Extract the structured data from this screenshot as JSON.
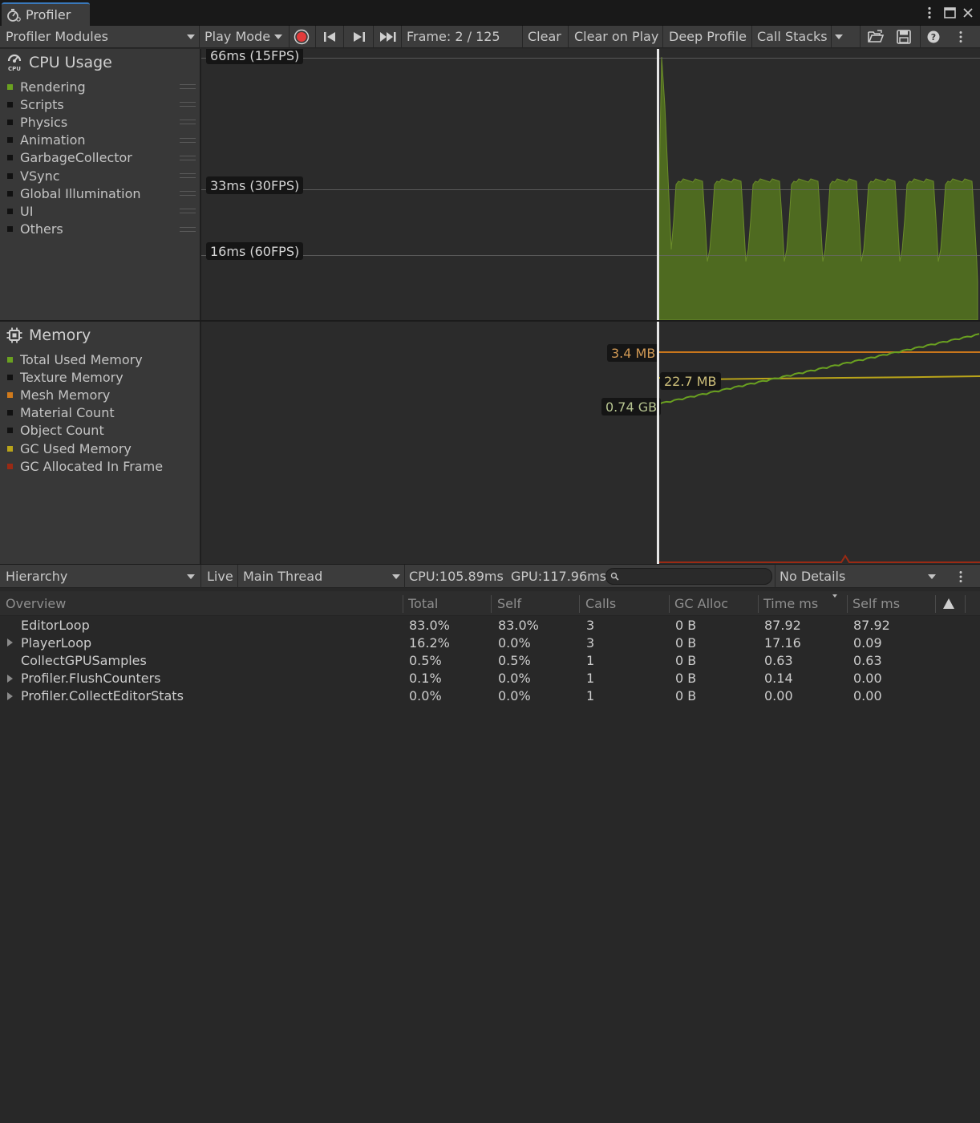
{
  "window": {
    "tab_label": "Profiler",
    "menu_icon": "kebab-vertical-icon",
    "maximize_icon": "maximize-icon",
    "close_icon": "close-icon"
  },
  "toolbar": {
    "modules_label": "Profiler Modules",
    "play_mode_label": "Play Mode",
    "frame_label": "Frame: 2 / 125",
    "clear_label": "Clear",
    "clear_on_play_label": "Clear on Play",
    "deep_profile_label": "Deep Profile",
    "call_stacks_label": "Call Stacks"
  },
  "cpu": {
    "title": "CPU Usage",
    "legend": [
      {
        "label": "Rendering",
        "color": "#6aa120"
      },
      {
        "label": "Scripts",
        "color": "#111111"
      },
      {
        "label": "Physics",
        "color": "#111111"
      },
      {
        "label": "Animation",
        "color": "#111111"
      },
      {
        "label": "GarbageCollector",
        "color": "#111111"
      },
      {
        "label": "VSync",
        "color": "#111111"
      },
      {
        "label": "Global Illumination",
        "color": "#111111"
      },
      {
        "label": "UI",
        "color": "#111111"
      },
      {
        "label": "Others",
        "color": "#111111"
      }
    ],
    "grid_labels": [
      "66ms (15FPS)",
      "33ms (30FPS)",
      "16ms (60FPS)"
    ],
    "series_color": "#4e6a20"
  },
  "memory": {
    "title": "Memory",
    "legend": [
      {
        "label": "Total Used Memory",
        "color": "#6aa120"
      },
      {
        "label": "Texture Memory",
        "color": "#111111"
      },
      {
        "label": "Mesh Memory",
        "color": "#d07a1c"
      },
      {
        "label": "Material Count",
        "color": "#111111"
      },
      {
        "label": "Object Count",
        "color": "#111111"
      },
      {
        "label": "GC Used Memory",
        "color": "#b9a41a"
      },
      {
        "label": "GC Allocated In Frame",
        "color": "#9a2a14"
      }
    ],
    "value_labels": {
      "mesh": "3.4 MB",
      "gc": "22.7 MB",
      "total": "0.74 GB"
    }
  },
  "hierarchy": {
    "view_label": "Hierarchy",
    "live_label": "Live",
    "thread_label": "Main Thread",
    "cpu_label": "CPU:105.89ms",
    "gpu_label": "GPU:117.96ms",
    "details_label": "No Details",
    "columns": [
      "Overview",
      "Total",
      "Self",
      "Calls",
      "GC Alloc",
      "Time ms",
      "Self ms"
    ],
    "rows": [
      {
        "name": "EditorLoop",
        "total": "83.0%",
        "self": "83.0%",
        "calls": "3",
        "gc": "0 B",
        "time": "87.92",
        "self_ms": "87.92",
        "expandable": false
      },
      {
        "name": "PlayerLoop",
        "total": "16.2%",
        "self": "0.0%",
        "calls": "3",
        "gc": "0 B",
        "time": "17.16",
        "self_ms": "0.09",
        "expandable": true
      },
      {
        "name": "CollectGPUSamples",
        "total": "0.5%",
        "self": "0.5%",
        "calls": "1",
        "gc": "0 B",
        "time": "0.63",
        "self_ms": "0.63",
        "expandable": false
      },
      {
        "name": "Profiler.FlushCounters",
        "total": "0.1%",
        "self": "0.0%",
        "calls": "1",
        "gc": "0 B",
        "time": "0.14",
        "self_ms": "0.00",
        "expandable": true
      },
      {
        "name": "Profiler.CollectEditorStats",
        "total": "0.0%",
        "self": "0.0%",
        "calls": "1",
        "gc": "0 B",
        "time": "0.00",
        "self_ms": "0.00",
        "expandable": true
      }
    ]
  }
}
